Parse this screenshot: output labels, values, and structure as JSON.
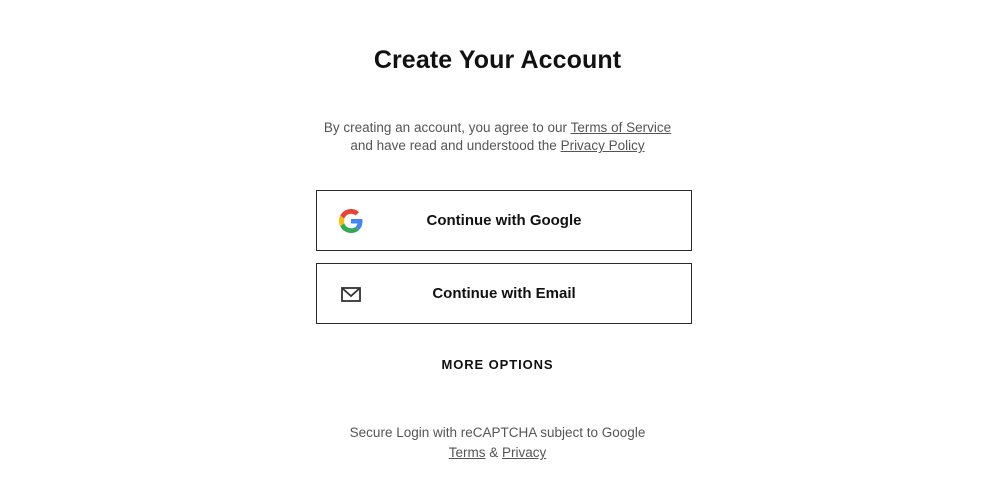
{
  "header": {
    "title": "Create Your Account"
  },
  "agreement": {
    "text_before": "By creating an account, you agree to our ",
    "terms_link": "Terms of Service",
    "text_middle": "and have read and understood the ",
    "privacy_link": "Privacy Policy"
  },
  "auth": {
    "google_label": "Continue with Google",
    "email_label": "Continue with Email",
    "google_icon": "google-g-icon",
    "email_icon": "envelope-icon"
  },
  "more_options_label": "MORE OPTIONS",
  "recaptcha": {
    "text": "Secure Login with reCAPTCHA subject to Google",
    "terms_link": "Terms",
    "separator": " & ",
    "privacy_link": "Privacy"
  },
  "colors": {
    "google_blue": "#4285F4",
    "google_red": "#EA4335",
    "google_yellow": "#FBBC05",
    "google_green": "#34A853",
    "text_primary": "#111111",
    "text_secondary": "#555555",
    "border": "#2b2b2b"
  }
}
